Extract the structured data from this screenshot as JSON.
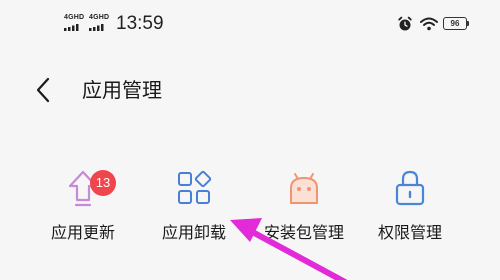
{
  "status_bar": {
    "sim1_label": "4GHD",
    "sim2_label": "4GHD",
    "time": "13:59",
    "battery_level": "96",
    "icons": [
      "signal-icon",
      "signal-icon",
      "alarm-icon",
      "wifi-icon",
      "battery-icon"
    ]
  },
  "header": {
    "back_icon": "chevron-left-icon",
    "title": "应用管理"
  },
  "tools": [
    {
      "label": "应用更新",
      "icon": "upload-arrow-icon",
      "badge": "13"
    },
    {
      "label": "应用卸载",
      "icon": "grid-apps-icon"
    },
    {
      "label": "安装包管理",
      "icon": "android-package-icon"
    },
    {
      "label": "权限管理",
      "icon": "lock-icon"
    }
  ],
  "colors": {
    "background": "#f6f6f6",
    "update_icon": "#c58bd8",
    "uninstall_icon": "#4a7fd6",
    "apk_icon": "#f09474",
    "permission_icon": "#4a86d6",
    "badge": "#f0454d",
    "annotation_arrow": "#e22ad9"
  }
}
